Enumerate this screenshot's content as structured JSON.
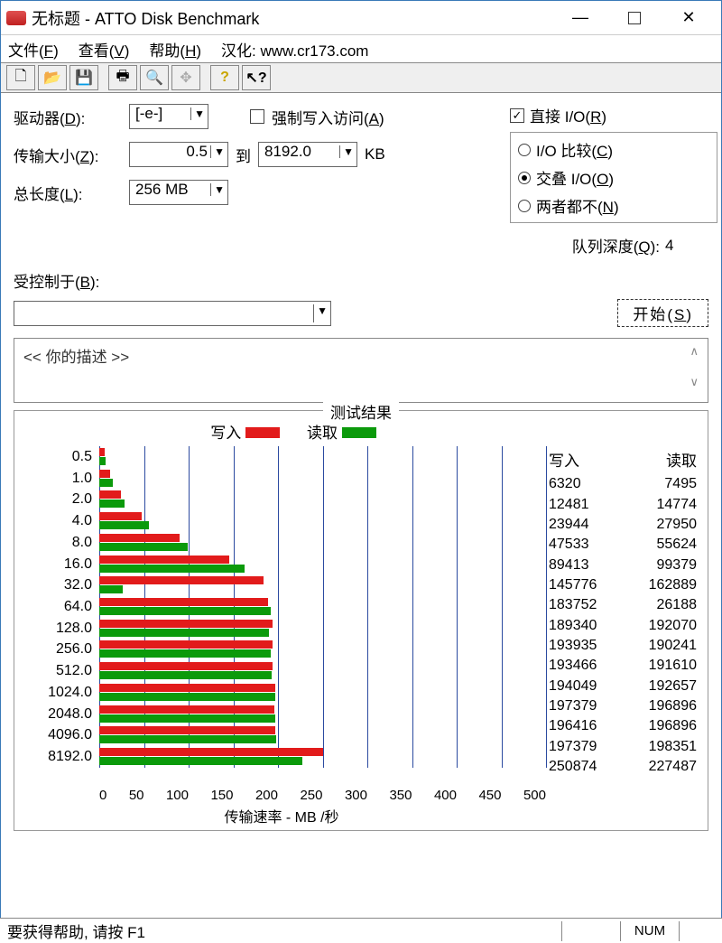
{
  "window": {
    "title": "无标题 - ATTO Disk Benchmark"
  },
  "menu": {
    "file": "文件",
    "file_k": "F",
    "view": "查看",
    "view_k": "V",
    "help": "帮助",
    "help_k": "H",
    "extra": "汉化: www.cr173.com"
  },
  "settings": {
    "drive_label": "驱动器",
    "drive_k": "D",
    "drive_value": "[-e-]",
    "force_write_label": "强制写入访问",
    "force_write_k": "A",
    "force_write_checked": false,
    "direct_io_label": "直接 I/O",
    "direct_io_k": "R",
    "direct_io_checked": true,
    "xfer_label": "传输大小",
    "xfer_k": "Z",
    "xfer_from": "0.5",
    "xfer_to_word": "到",
    "xfer_to": "8192.0",
    "xfer_unit": "KB",
    "io_compare": "I/O 比较",
    "io_compare_k": "C",
    "overlap": "交叠 I/O",
    "overlap_k": "O",
    "neither": "两者都不",
    "neither_k": "N",
    "length_label": "总长度",
    "length_k": "L",
    "length_value": "256 MB",
    "queue_label": "队列深度",
    "queue_k": "Q",
    "queue_value": "4",
    "controlled_label": "受控制于",
    "controlled_k": "B",
    "start_label": "开始",
    "start_k": "S"
  },
  "desc": {
    "placeholder": "<< 你的描述  >>"
  },
  "results": {
    "title": "测试结果",
    "write": "写入",
    "read": "读取",
    "x_label": "传输速率 - MB /秒"
  },
  "chart_data": {
    "type": "bar",
    "xlabel": "传输速率 - MB /秒",
    "xlim": [
      0,
      500
    ],
    "xticks": [
      0,
      50,
      100,
      150,
      200,
      250,
      300,
      350,
      400,
      450,
      500
    ],
    "categories": [
      "0.5",
      "1.0",
      "2.0",
      "4.0",
      "8.0",
      "16.0",
      "32.0",
      "64.0",
      "128.0",
      "256.0",
      "512.0",
      "1024.0",
      "2048.0",
      "4096.0",
      "8192.0"
    ],
    "series": [
      {
        "name": "写入",
        "unit": "KB/s",
        "color": "#e21b1b",
        "values": [
          6320,
          12481,
          23944,
          47533,
          89413,
          145776,
          183752,
          189340,
          193935,
          193466,
          194049,
          197379,
          196416,
          197379,
          250874
        ]
      },
      {
        "name": "读取",
        "unit": "KB/s",
        "color": "#0b9a0b",
        "values": [
          7495,
          14774,
          27950,
          55624,
          99379,
          162889,
          26188,
          192070,
          190241,
          191610,
          192657,
          196896,
          196896,
          198351,
          227487
        ]
      }
    ]
  },
  "status": {
    "help": "要获得帮助, 请按 F1",
    "num": "NUM"
  }
}
